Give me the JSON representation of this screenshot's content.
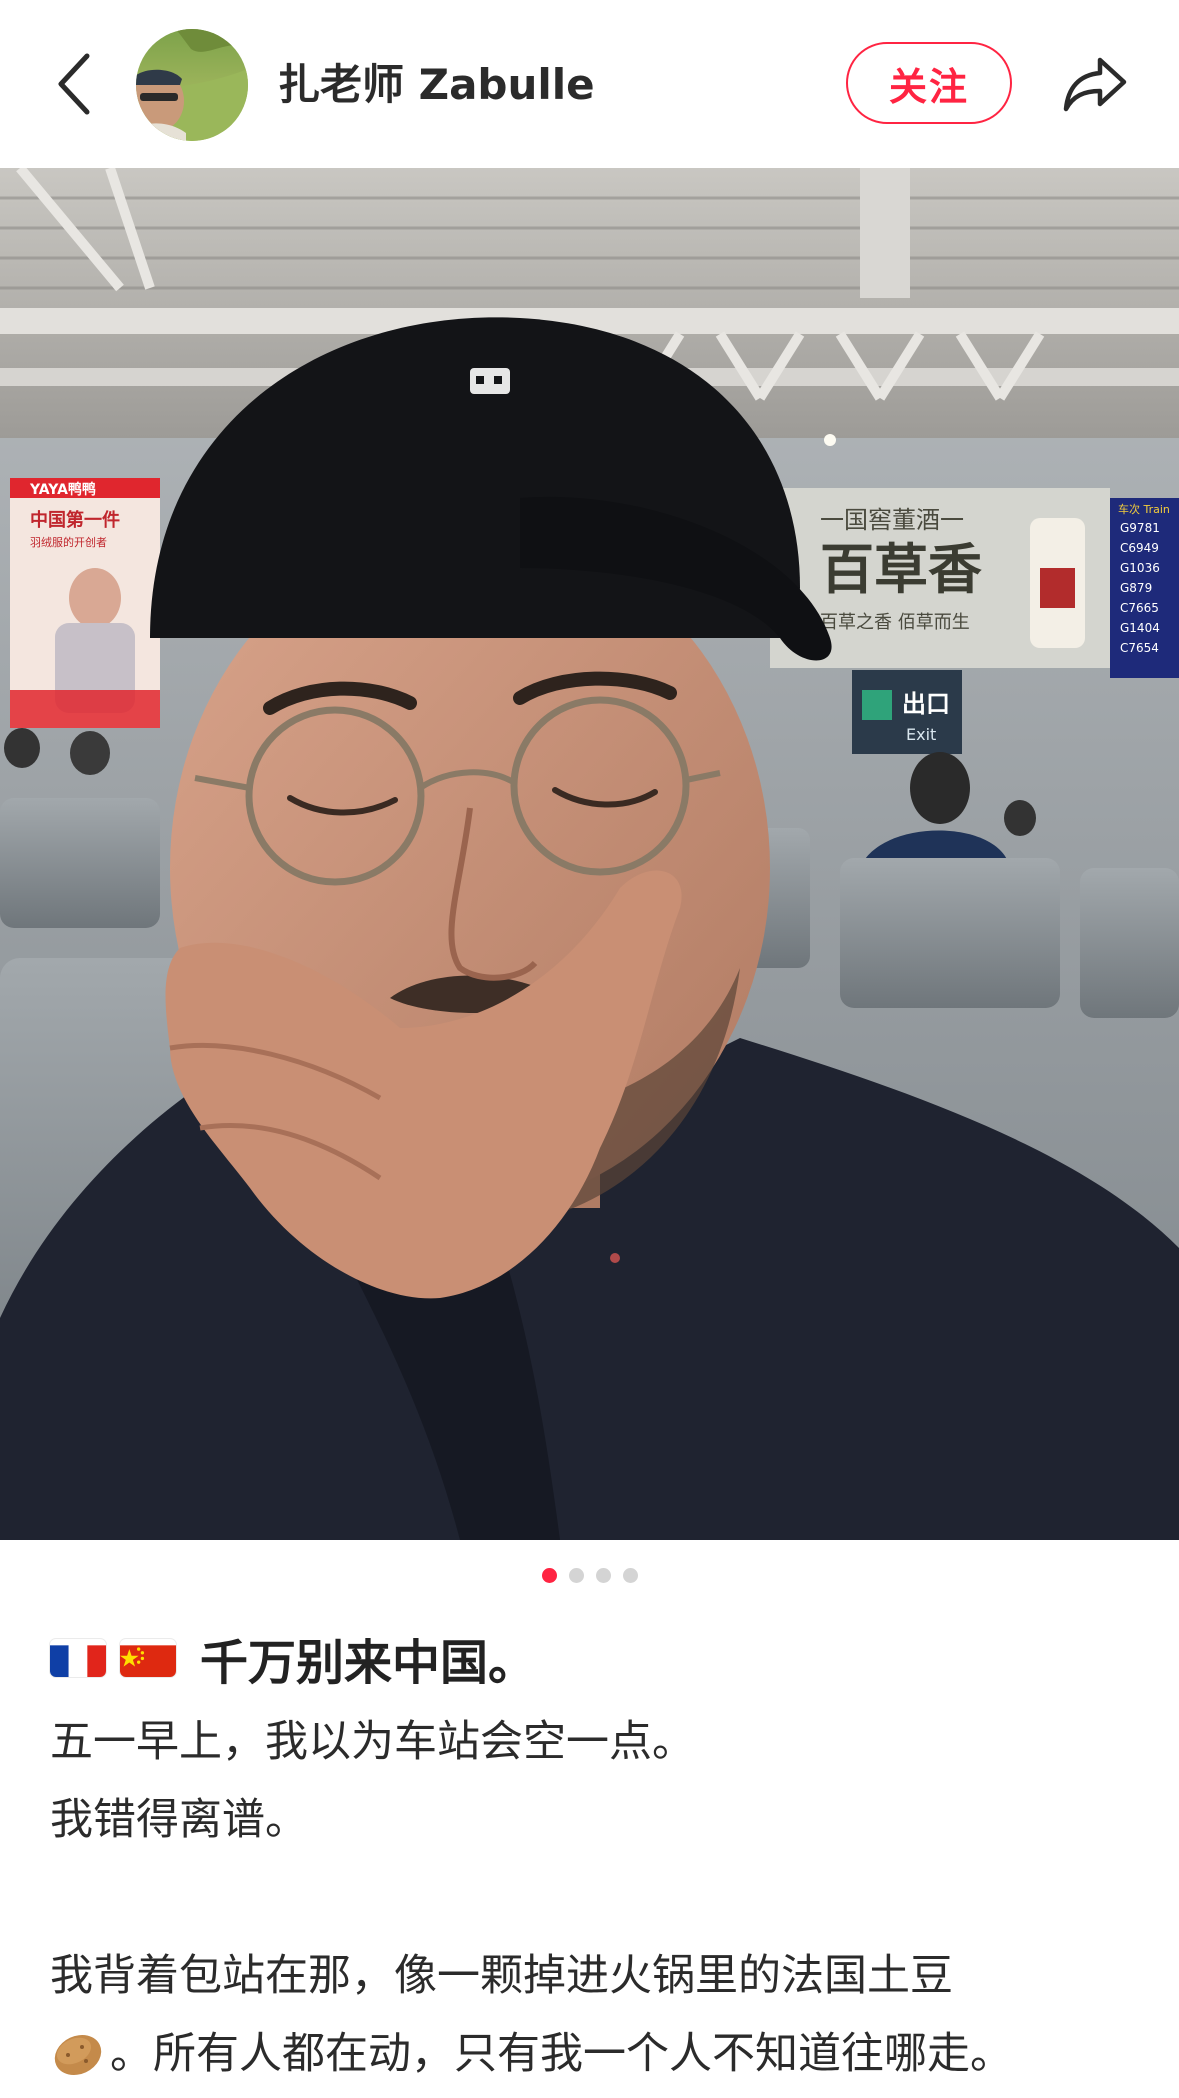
{
  "header": {
    "back_icon": "chevron-left-icon",
    "author_name": "扎老师 Zabulle",
    "follow_label": "关注",
    "share_icon": "share-icon"
  },
  "carousel": {
    "total": 4,
    "active_index": 0
  },
  "note": {
    "title_flags": [
      "flag-france-icon",
      "flag-china-icon"
    ],
    "title": "千万别来中国。",
    "lines": [
      "五一早上，我以为车站会空一点。",
      "我错得离谱。",
      "",
      "我背着包站在那，像一颗掉进火锅里的法国土豆"
    ],
    "last_line_icon": "potato-icon",
    "last_line": "。所有人都在动，只有我一个人不知道往哪走。"
  },
  "photo_signs": {
    "ad_left_brand": "YAYA鸭鸭",
    "ad_left_line1": "中国第一件",
    "ad_left_line2": "羽绒服的开创者",
    "ad_right_top": "一国窖董酒一",
    "ad_right_main": "百草香",
    "ad_right_sub": "百草之香  佰草而生",
    "exit_cn": "出口",
    "exit_en": "Exit",
    "board_header": "车次 Train",
    "board_trains": [
      "G9781",
      "C6949",
      "G1036",
      "G879",
      "C7665",
      "G1404",
      "C7654"
    ]
  },
  "colors": {
    "accent": "#ff2442",
    "text": "#222222",
    "dot_inactive": "#d4d4d4"
  }
}
